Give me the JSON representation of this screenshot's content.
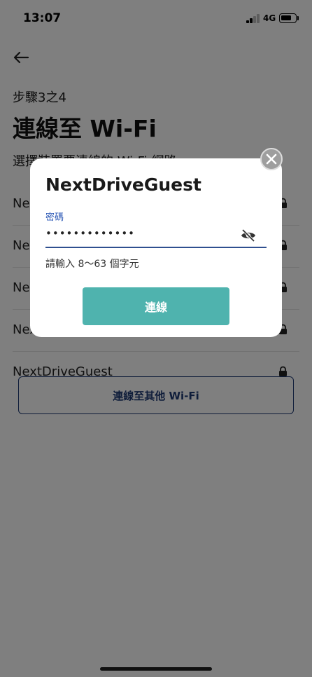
{
  "status_bar": {
    "time": "13:07",
    "network": "4G",
    "battery_level": 0.78
  },
  "page": {
    "step": "步驟3之4",
    "title": "連線至 Wi-Fi",
    "subtitle": "選擇裝置要連線的 Wi-Fi 網路"
  },
  "networks": [
    {
      "ssid": "NextDriveGuest"
    },
    {
      "ssid": "NextDriveGuest"
    },
    {
      "ssid": "NextDriveGuest"
    },
    {
      "ssid": "NextDriveGuest"
    },
    {
      "ssid": "NextDriveGuest"
    }
  ],
  "other_wifi_label": "連線至其他 Wi-Fi",
  "dialog": {
    "title": "NextDriveGuest",
    "password_label": "密碼",
    "password_value": "•••••••••••••",
    "hint": "請輸入 8～63 個字元",
    "connect_label": "連線"
  },
  "colors": {
    "accent": "#4fb3ae",
    "primary": "#1f3a75",
    "label_blue": "#2f5bb7"
  }
}
